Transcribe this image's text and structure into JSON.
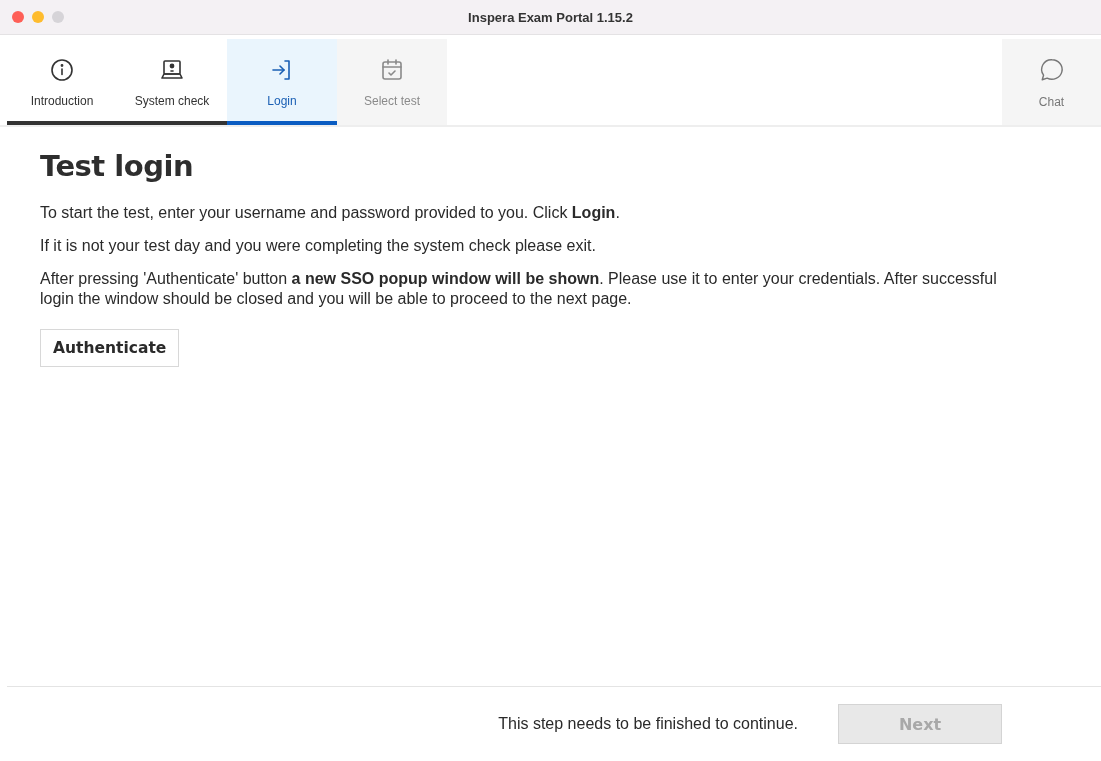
{
  "window": {
    "title": "Inspera Exam Portal 1.15.2"
  },
  "tabs": [
    {
      "label": "Introduction",
      "selected": false,
      "completed": true,
      "disabled": false
    },
    {
      "label": "System check",
      "selected": false,
      "completed": true,
      "disabled": false
    },
    {
      "label": "Login",
      "selected": true,
      "completed": false,
      "disabled": false
    },
    {
      "label": "Select test",
      "selected": false,
      "completed": false,
      "disabled": true
    }
  ],
  "chat": {
    "label": "Chat"
  },
  "heading": "Test login",
  "paragraphs": [
    "To start the test, enter your username and password provided to you. Click **Login**.",
    "If it is not your test day and you were completing the system check please exit.",
    "After pressing 'Authenticate' button **a new SSO popup window will be shown**. Please use it to enter your credentials. After successful login the window should be closed and you will be able to proceed to the next page."
  ],
  "authenticate_button": {
    "label": "Authenticate"
  },
  "footer": {
    "message": "This step needs to be finished to continue.",
    "next_button": {
      "label": "Next",
      "disabled": true
    }
  }
}
